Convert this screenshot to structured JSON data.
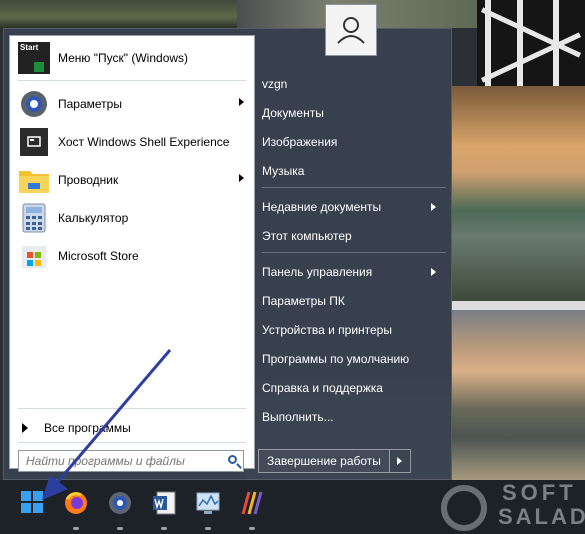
{
  "start_menu": {
    "pinned": [
      {
        "label": "Меню \"Пуск\" (Windows)",
        "icon": "start-menu-app-icon",
        "has_submenu": false
      },
      {
        "label": "Параметры",
        "icon": "settings-gear-icon",
        "has_submenu": true
      },
      {
        "label": "Хост Windows Shell Experience",
        "icon": "shell-experience-icon",
        "has_submenu": false
      },
      {
        "label": "Проводник",
        "icon": "folder-icon",
        "has_submenu": true
      },
      {
        "label": "Калькулятор",
        "icon": "calculator-icon",
        "has_submenu": false
      },
      {
        "label": "Microsoft Store",
        "icon": "store-icon",
        "has_submenu": false
      }
    ],
    "start_tile_text": "Start",
    "all_programs": "Все программы",
    "search_placeholder": "Найти программы и файлы",
    "right_pane": [
      {
        "label": "vzgn",
        "has_submenu": false
      },
      {
        "label": "Документы",
        "has_submenu": false
      },
      {
        "label": "Изображения",
        "has_submenu": false
      },
      {
        "label": "Музыка",
        "has_submenu": false
      },
      {
        "label": "Недавние документы",
        "has_submenu": true
      },
      {
        "label": "Этот компьютер",
        "has_submenu": false
      },
      {
        "label": "Панель управления",
        "has_submenu": true
      },
      {
        "label": "Параметры ПК",
        "has_submenu": false
      },
      {
        "label": "Устройства и принтеры",
        "has_submenu": false
      },
      {
        "label": "Программы по умолчанию",
        "has_submenu": false
      },
      {
        "label": "Справка и поддержка",
        "has_submenu": false
      },
      {
        "label": "Выполнить...",
        "has_submenu": false
      }
    ],
    "shutdown": "Завершение работы"
  },
  "taskbar": {
    "items": [
      {
        "name": "windows-start",
        "icon": "windows-logo-icon",
        "running": false
      },
      {
        "name": "firefox",
        "icon": "firefox-icon",
        "running": true
      },
      {
        "name": "settings",
        "icon": "settings-icon",
        "running": true
      },
      {
        "name": "word",
        "icon": "word-icon",
        "running": true
      },
      {
        "name": "resource-monitor",
        "icon": "monitor-icon",
        "running": true
      },
      {
        "name": "app",
        "icon": "stripes-app-icon",
        "running": true
      }
    ]
  },
  "watermark": {
    "line1": "SOFT",
    "line2": "SALAD"
  },
  "colors": {
    "accent_blue": "#2f57b8",
    "arrow": "#2c3fa0",
    "taskbar": "#1d2229"
  }
}
